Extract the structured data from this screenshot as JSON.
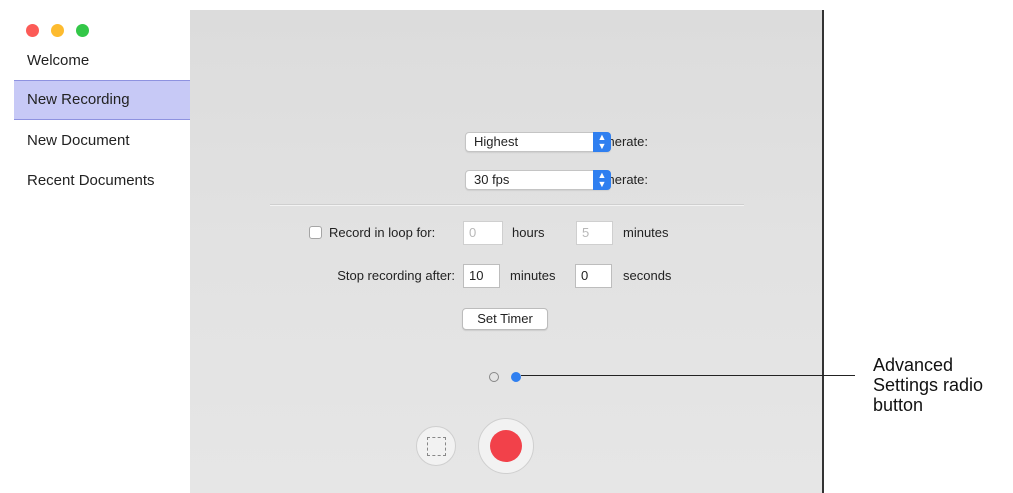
{
  "sidebar": {
    "items": [
      {
        "label": "Welcome"
      },
      {
        "label": "New Recording"
      },
      {
        "label": "New Document"
      },
      {
        "label": "Recent Documents"
      }
    ]
  },
  "form": {
    "desktop_framerate_label": "Record Desktop Framerate:",
    "desktop_framerate_value": "Highest",
    "timeline_framerate_label": "Timeline Framerate:",
    "timeline_framerate_value": "30 fps",
    "loop_label": "Record in loop for:",
    "loop_hours_value": "0",
    "loop_hours_unit": "hours",
    "loop_minutes_value": "5",
    "loop_minutes_unit": "minutes",
    "stop_label": "Stop recording after:",
    "stop_minutes_value": "10",
    "stop_minutes_unit": "minutes",
    "stop_seconds_value": "0",
    "stop_seconds_unit": "seconds",
    "set_timer_label": "Set Timer"
  },
  "callout": {
    "line1": "Advanced",
    "line2": "Settings radio",
    "line3": "button"
  },
  "colors": {
    "accent": "#2f7ff0",
    "selected_item": "#c7c9f6",
    "record": "#f2414a"
  }
}
